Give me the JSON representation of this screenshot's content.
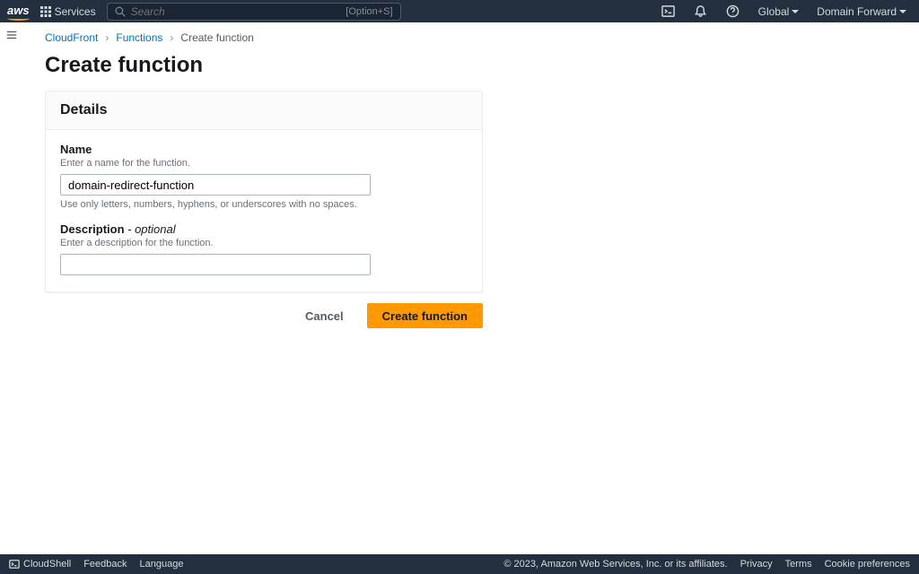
{
  "topnav": {
    "logo": "aws",
    "services": "Services",
    "search_placeholder": "Search",
    "search_hint": "[Option+S]",
    "region": "Global",
    "account": "Domain Forward"
  },
  "breadcrumb": {
    "root": "CloudFront",
    "second": "Functions",
    "current": "Create function"
  },
  "page_title": "Create function",
  "panel": {
    "header": "Details",
    "name": {
      "label": "Name",
      "desc": "Enter a name for the function.",
      "value": "domain-redirect-function",
      "hint": "Use only letters, numbers, hyphens, or underscores with no spaces."
    },
    "description": {
      "label": "Description",
      "optional": " - optional",
      "desc": "Enter a description for the function.",
      "value": ""
    }
  },
  "actions": {
    "cancel": "Cancel",
    "submit": "Create function"
  },
  "footer": {
    "cloudshell": "CloudShell",
    "feedback": "Feedback",
    "language": "Language",
    "copyright": "© 2023, Amazon Web Services, Inc. or its affiliates.",
    "privacy": "Privacy",
    "terms": "Terms",
    "cookies": "Cookie preferences"
  }
}
